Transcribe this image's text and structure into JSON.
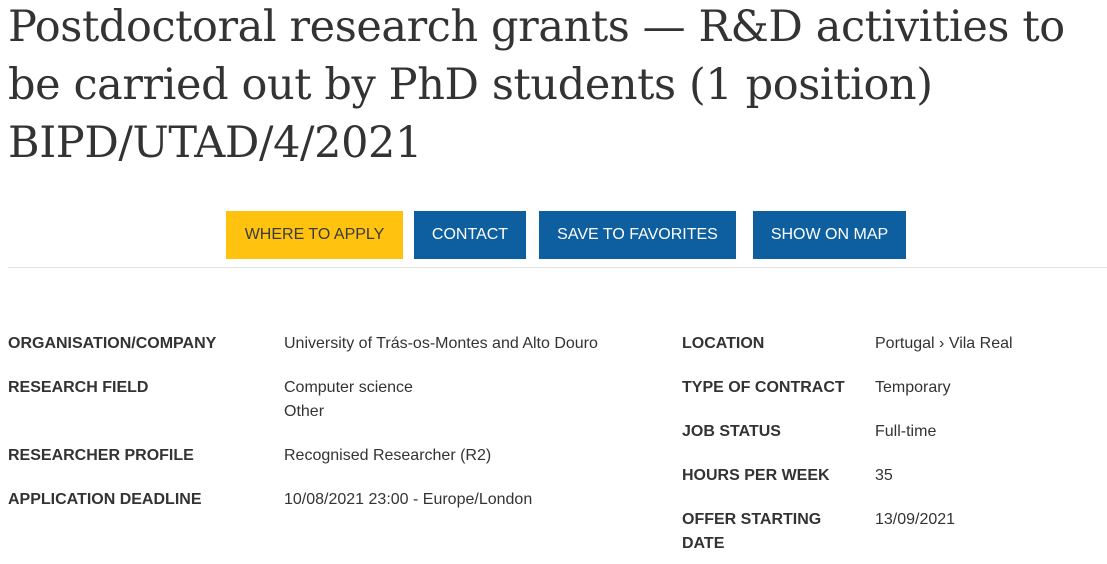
{
  "page": {
    "title": "Postdoctoral research grants — R&D activities to be carried out by PhD students (1 position) BIPD/UTAD/4/2021"
  },
  "actions": {
    "where_to_apply": "WHERE TO APPLY",
    "contact": "CONTACT",
    "save_to_favorites": "SAVE TO FAVORITES",
    "show_on_map": "SHOW ON MAP",
    "colors": {
      "primary": "#0e5fa0",
      "highlight": "#ffc20e"
    }
  },
  "details_left": [
    {
      "label": "ORGANISATION/COMPANY",
      "value": "University of Trás-os-Montes and Alto Douro"
    },
    {
      "label": "RESEARCH FIELD",
      "value": "Computer science",
      "value2": "Other"
    },
    {
      "label": "RESEARCHER PROFILE",
      "value": "Recognised Researcher (R2)"
    },
    {
      "label": "APPLICATION DEADLINE",
      "value": "10/08/2021 23:00 - Europe/London"
    }
  ],
  "details_right": [
    {
      "label": "LOCATION",
      "value": "Portugal › Vila Real"
    },
    {
      "label": "TYPE OF CONTRACT",
      "value": "Temporary"
    },
    {
      "label": "JOB STATUS",
      "value": "Full-time"
    },
    {
      "label": "HOURS PER WEEK",
      "value": "35"
    },
    {
      "label": "OFFER STARTING",
      "label2": "DATE",
      "value": "13/09/2021"
    }
  ]
}
